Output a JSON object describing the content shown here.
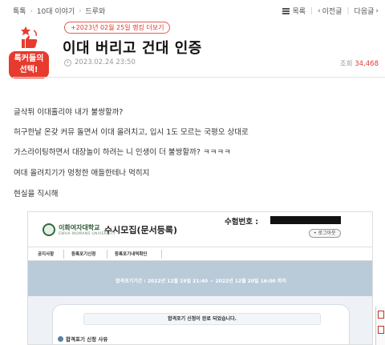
{
  "breadcrumb": [
    "톡톡",
    "10대 이야기",
    "드루와"
  ],
  "nav": {
    "list": "목록",
    "prev": "이전글",
    "next": "다음글"
  },
  "badge": {
    "label_line1": "톡커들의",
    "label_line2": "선택!"
  },
  "rank_pill": "+2023년 02월 25일 랭킹 더보기",
  "post": {
    "title": "이대 버리고 건대 인증",
    "date": "2023.02.24 23:50",
    "views_label": "조회",
    "views_count": "34,468"
  },
  "body_lines": [
    "글삭튀 이대홀리야 내가 불쌍할까?",
    "허구한날 온갖 커뮤 돌면서 이대 올려치고, 입시 1도 모르는 국평오 상대로",
    "가스라이팅하면서 대장놀이 하려는 니 인생이 더 불쌍할까? ㅋㅋㅋㅋ",
    "여대 올려치기가 멍청한 애들한테나 먹히지",
    "현실을 직시해"
  ],
  "capture": {
    "univ_name": "이화여자대학교",
    "univ_sub": "EWHA WOMANS UNIVERSITY",
    "title": "수시모집(문서등록)",
    "exam_label": "수험번호 :",
    "logout": "• 로그아웃",
    "nav": [
      "공지사항",
      "등록포기신청",
      "등록포기내역확인"
    ],
    "period": "합격포기기간 : 2022년 12월 19일 21:40 ~ 2022년 12월 20일 16:00 까지",
    "message": "합격포기 신청이 완료 되었습니다.",
    "reason": "합격포기 신청 사유"
  },
  "colors": {
    "accent": "#e03a2e",
    "badge_bg": "#e63b2e",
    "univ_green": "#2e6b3b"
  }
}
